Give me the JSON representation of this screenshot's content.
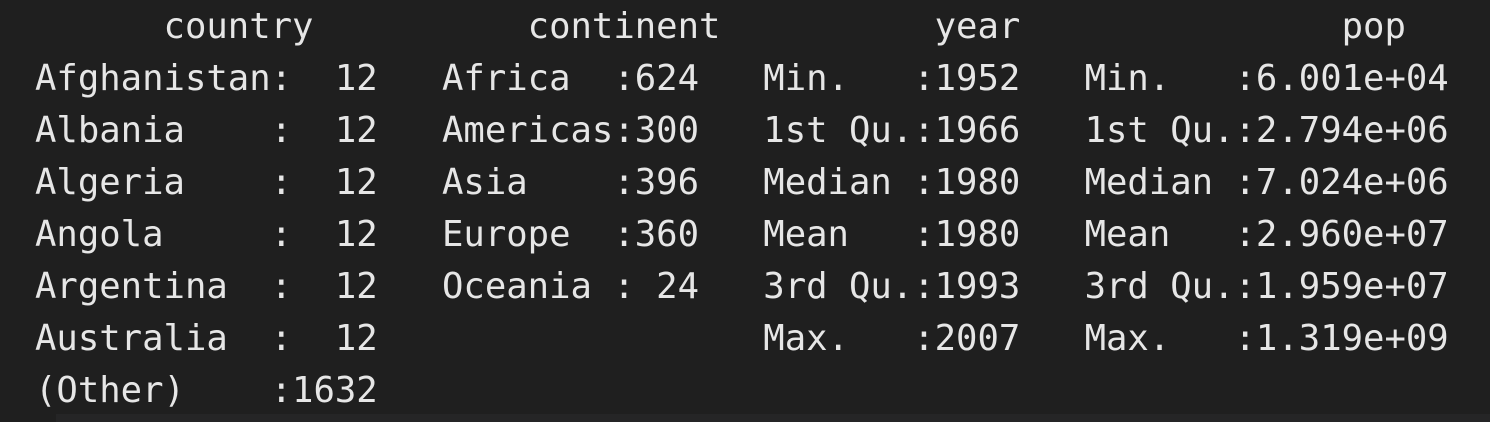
{
  "console": {
    "header": "      country          continent          year               pop           ",
    "lines": [
      "Afghanistan:  12   Africa  :624   Min.   :1952   Min.   :6.001e+04  ",
      "Albania    :  12   Americas:300   1st Qu.:1966   1st Qu.:2.794e+06  ",
      "Algeria    :  12   Asia    :396   Median :1980   Median :7.024e+06  ",
      "Angola     :  12   Europe  :360   Mean   :1980   Mean   :2.960e+07  ",
      "Argentina  :  12   Oceania : 24   3rd Qu.:1993   3rd Qu.:1.959e+07  ",
      "Australia  :  12                  Max.   :2007   Max.   :1.319e+09  ",
      "(Other)    :1632                                                    "
    ]
  },
  "colors": {
    "background": "#1f1f1f",
    "text": "#e6e6e6"
  }
}
